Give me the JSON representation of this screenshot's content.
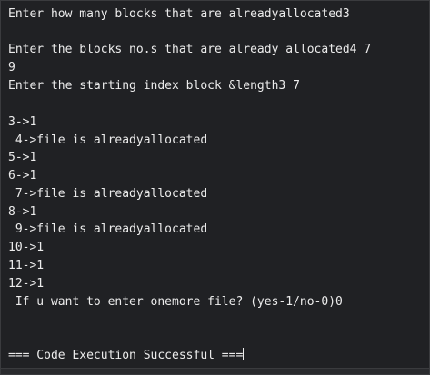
{
  "output": {
    "lines": [
      "Enter how many blocks that are alreadyallocated3",
      "Enter the blocks no.s that are already allocated4 7",
      "9",
      "Enter the starting index block &length3 7",
      "3->1",
      " 4->file is alreadyallocated",
      "5->1",
      "6->1",
      " 7->file is alreadyallocated",
      "8->1",
      " 9->file is alreadyallocated",
      "10->1",
      "11->1",
      "12->1",
      " If u want to enter onemore file? (yes-1/no-0)0",
      "=== Code Execution Successful ==="
    ]
  },
  "colors": {
    "background": "#202124",
    "text": "#ececec"
  }
}
